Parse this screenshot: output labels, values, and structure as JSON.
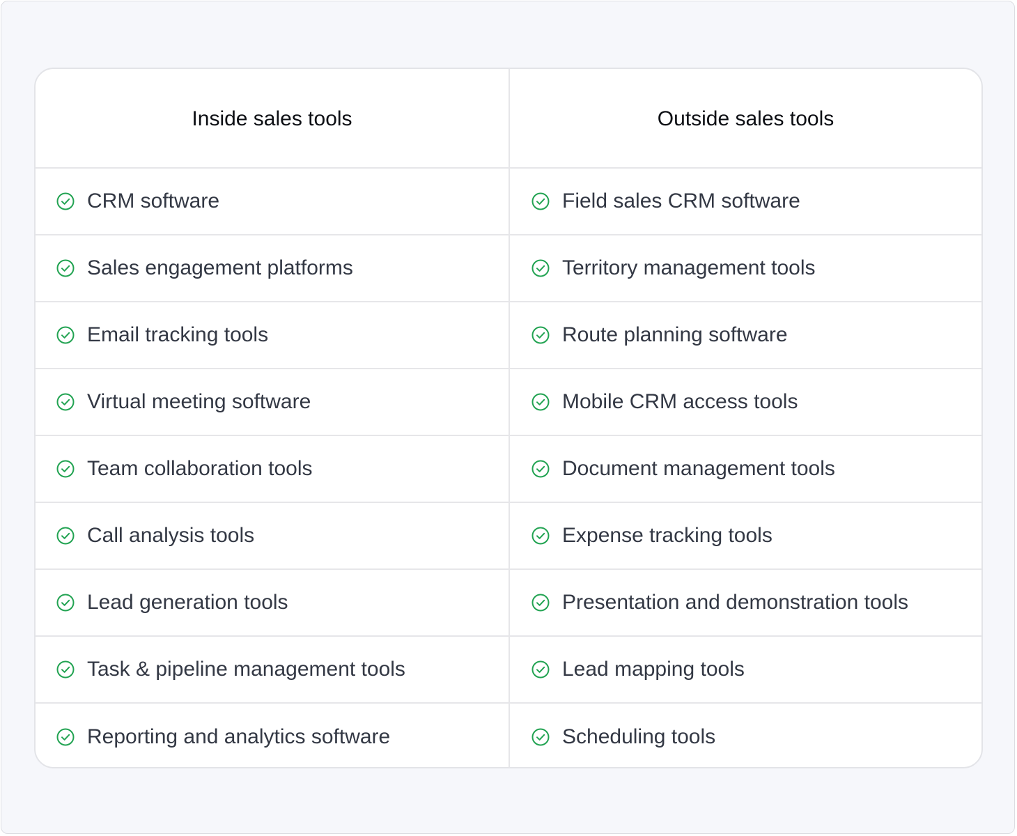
{
  "table": {
    "headers": [
      "Inside sales tools",
      "Outside sales tools"
    ],
    "rows": [
      [
        "CRM software",
        "Field sales CRM software"
      ],
      [
        "Sales engagement platforms",
        "Territory management tools"
      ],
      [
        "Email tracking tools",
        "Route planning software"
      ],
      [
        "Virtual meeting software",
        "Mobile CRM access tools"
      ],
      [
        "Team collaboration tools",
        "Document management tools"
      ],
      [
        "Call analysis tools",
        "Expense tracking tools"
      ],
      [
        "Lead generation tools",
        "Presentation and demonstration tools"
      ],
      [
        "Task & pipeline management tools",
        "Lead mapping tools"
      ],
      [
        "Reporting and analytics software",
        "Scheduling tools"
      ]
    ],
    "icon": "check-circle-icon",
    "accent_color": "#22a352"
  }
}
